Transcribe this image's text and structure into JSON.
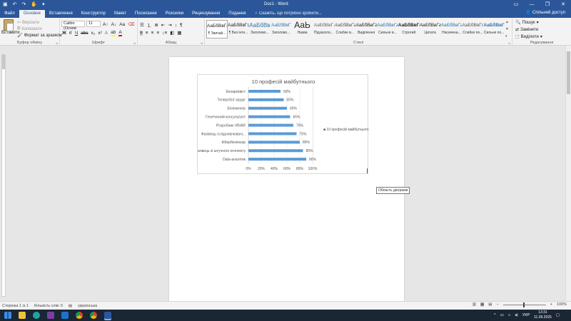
{
  "window": {
    "title": "Doc1 - Word",
    "controls": [
      "ribbon-options",
      "minimize",
      "restore",
      "close"
    ]
  },
  "qat": {
    "icons": [
      "save-icon",
      "undo-icon",
      "redo-icon",
      "touch-mode-icon",
      "customize-icon"
    ]
  },
  "tabs": [
    {
      "id": "file",
      "label": "Файл"
    },
    {
      "id": "home",
      "label": "Основне",
      "active": true
    },
    {
      "id": "insert",
      "label": "Вставлення"
    },
    {
      "id": "design",
      "label": "Конструктор"
    },
    {
      "id": "layout",
      "label": "Макет"
    },
    {
      "id": "references",
      "label": "Посилання"
    },
    {
      "id": "mailings",
      "label": "Розсилки"
    },
    {
      "id": "review",
      "label": "Рецензування"
    },
    {
      "id": "view",
      "label": "Подання"
    }
  ],
  "tell_me": {
    "placeholder": "Скажіть, що потрібно зробити..."
  },
  "share_label": "Спільний доступ",
  "ribbon": {
    "clipboard": {
      "paste": "Вставити",
      "cut": "Вирізати",
      "copy": "Копіювати",
      "format_painter": "Формат за зразком",
      "group": "Буфер обміну"
    },
    "font": {
      "font_name": "Calibri (Основ",
      "font_size": "11",
      "group": "Шрифт"
    },
    "paragraph": {
      "group": "Абзац"
    },
    "styles": {
      "group": "Стилі",
      "items": [
        {
          "sample": "АаБбВвГг,",
          "name": "¶ Звичай..."
        },
        {
          "sample": "АаБбВвГг,",
          "name": "¶ Без інте..."
        },
        {
          "sample": "АаБбВв",
          "name": "Заголово..."
        },
        {
          "sample": "АаБбВвГ",
          "name": "Заголово..."
        },
        {
          "sample": "АаЬ",
          "name": "Назва"
        },
        {
          "sample": "АаБбВвГ",
          "name": "Підзаголо..."
        },
        {
          "sample": "АаБбВвГг",
          "name": "Слабке в..."
        },
        {
          "sample": "АаБбВвГг",
          "name": "Виділення"
        },
        {
          "sample": "АаБбВвГг",
          "name": "Сильне в..."
        },
        {
          "sample": "АаБбВвГг",
          "name": "Строгий"
        },
        {
          "sample": "АаБбВвГг",
          "name": "Цитата"
        },
        {
          "sample": "АаБбВвГг",
          "name": "Насичена..."
        },
        {
          "sample": "АаБбВвГг",
          "name": "Слабке по..."
        },
        {
          "sample": "АаБбВвГг",
          "name": "Сильне по..."
        }
      ]
    },
    "editing": {
      "find": "Пошук",
      "replace": "Замінити",
      "select": "Виділити",
      "group": "Редагування"
    }
  },
  "chart_data": {
    "type": "bar",
    "orientation": "horizontal",
    "title": "10 професій майбутнього",
    "categories": [
      "Екоаріхівіст",
      "Телеробот-хірург",
      "Біоінженер",
      "Генетичний консультант",
      "Розробник VR/AR",
      "Фахівець із відновлювані...",
      "Кібербезпекар",
      "Фахівець зі штучного інтелекту",
      "Data-аналітик"
    ],
    "series": [
      {
        "name": "10 професій майбутнього",
        "values": [
          50,
          55,
          60,
          65,
          70,
          75,
          80,
          85,
          90
        ]
      }
    ],
    "data_labels": [
      "50%",
      "55%",
      "60%",
      "65%",
      "70%",
      "75%",
      "80%",
      "85%",
      "90%"
    ],
    "x_ticks": [
      "0%",
      "20%",
      "40%",
      "60%",
      "80%",
      "100%"
    ],
    "xlim": [
      0,
      100
    ],
    "legend_position": "right",
    "legend_label": "■ 10 професій майбутнього",
    "bar_color": "#5b9bd5"
  },
  "tooltip": "Область діаграми",
  "status": {
    "page": "Сторінка 1 із 1",
    "words": "Кількість слів: 0",
    "language": "українська",
    "zoom": "100%"
  },
  "taskbar": {
    "apps": [
      "windows-start",
      "file-explorer",
      "edge",
      "onenote",
      "outlook",
      "chrome",
      "chrome-alt",
      "word"
    ],
    "lang": "УКР",
    "time": "13:31",
    "date": "11.09.2025"
  }
}
